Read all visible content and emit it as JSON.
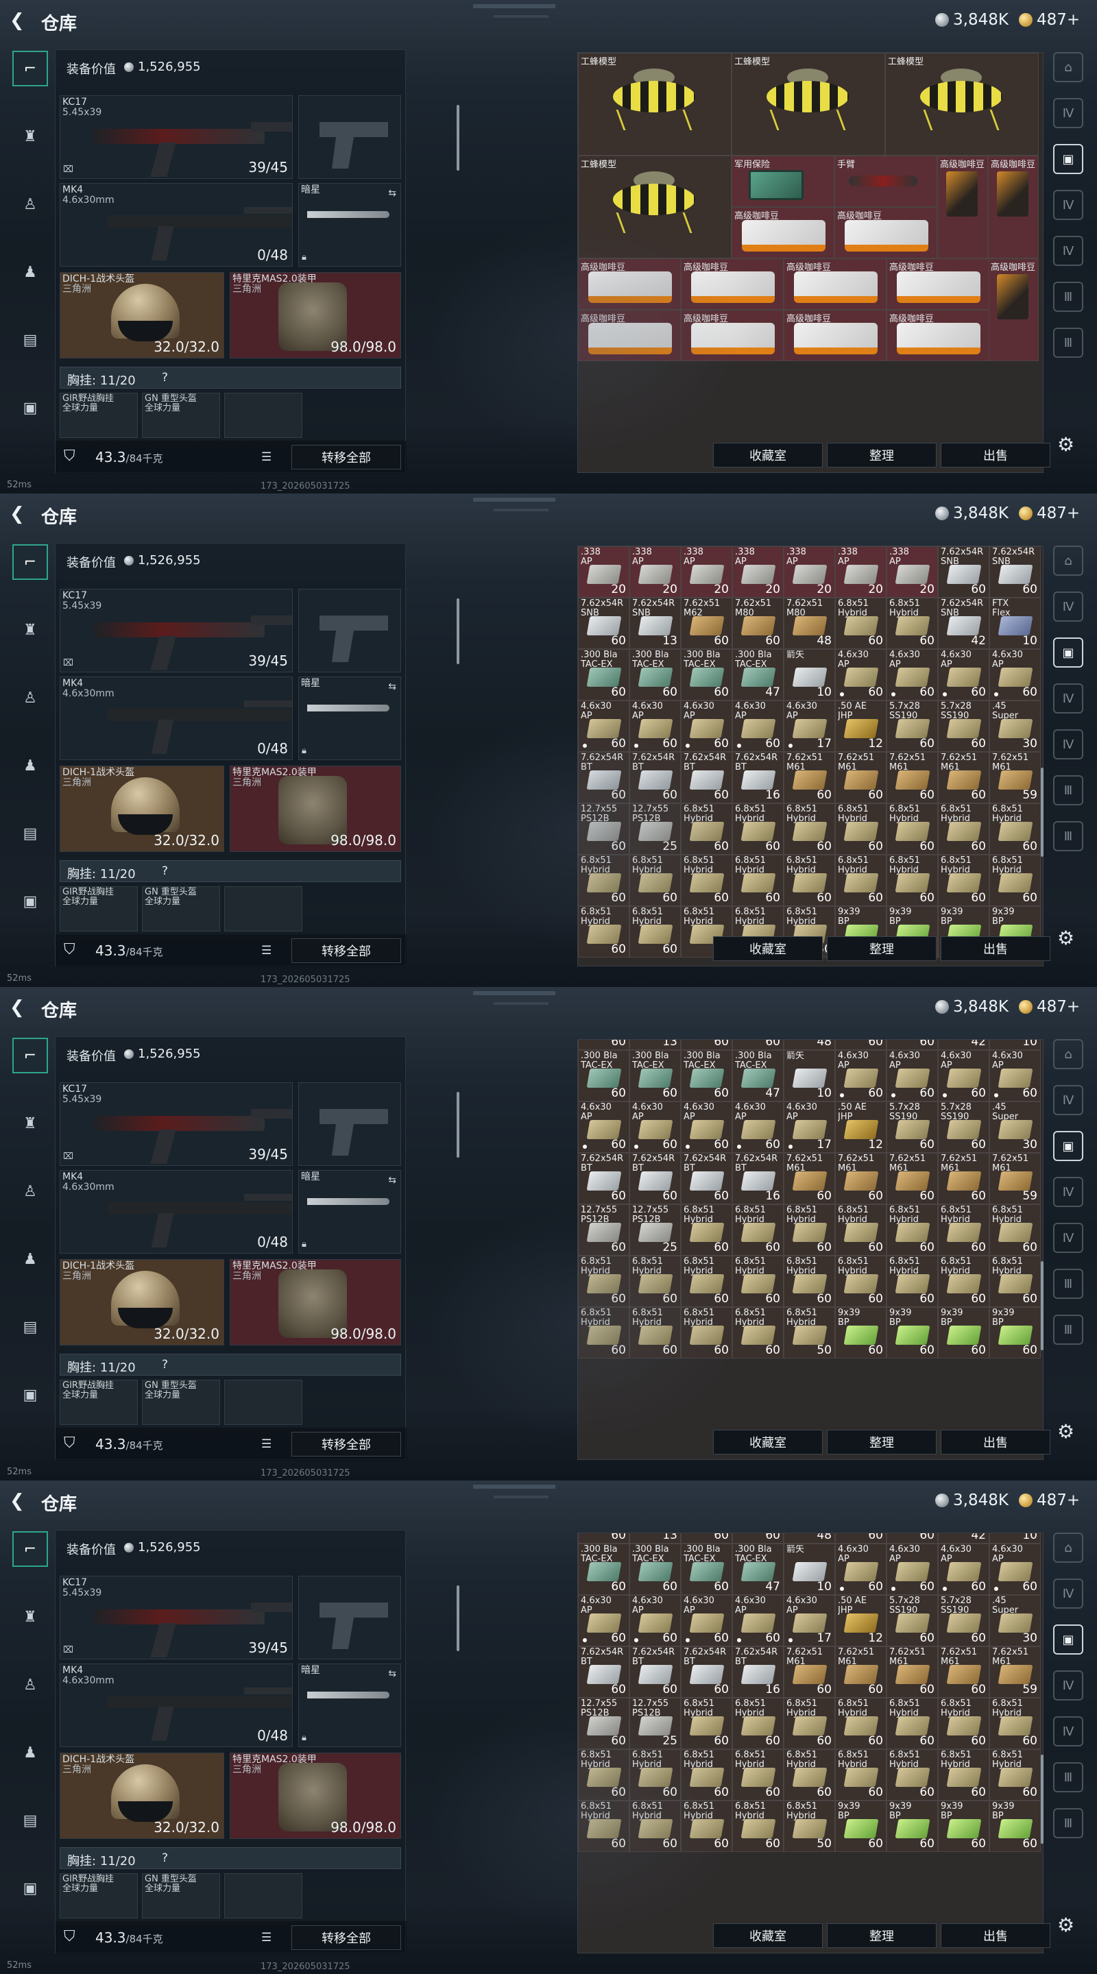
{
  "header": {
    "title": "仓库",
    "silver": "3,848K",
    "gold": "487+"
  },
  "loadout": {
    "value_label": "装备价值",
    "value": "1,526,955",
    "primary": {
      "name": "KC17",
      "caliber": "5.45x39",
      "ammo": "39/45"
    },
    "secondary": {
      "name": "MK4",
      "caliber": "4.6x30mm",
      "ammo": "0/48"
    },
    "melee": {
      "name": "暗星"
    },
    "helmet": {
      "name": "DICH-1战术头盔",
      "sub": "三角洲",
      "durability": "32.0/32.0"
    },
    "armor": {
      "name": "特里克MAS2.0装甲",
      "sub": "三角洲",
      "durability": "98.0/98.0"
    },
    "rig_label": "胸挂:",
    "rig_value": "11/20",
    "rig_q": "?",
    "rig_items": [
      {
        "name": "GIR野战胸挂",
        "sub": "全球力量"
      },
      {
        "name": "GN 重型头盔",
        "sub": "全球力量"
      }
    ],
    "weight": "43.3",
    "weight_max": "/84千克",
    "transfer_all": "转移全部"
  },
  "stash_buttons": {
    "collection": "收藏室",
    "sort": "整理",
    "sell": "出售"
  },
  "status": {
    "ping": "52ms",
    "version": "173_202605031725"
  },
  "colors": {
    "accent_teal": "#2ea58e",
    "slot_red": "#4b2329",
    "stash_bg": "#2e2b2b"
  },
  "icons": [
    "back-icon",
    "gun-icon",
    "vest-icon",
    "backpack-icon",
    "bag-icon",
    "case-icon",
    "briefcase-icon",
    "settings-icon",
    "lock-icon",
    "list-icon",
    "swap-icon"
  ],
  "frame1": {
    "wasp_label": "工蜂模型",
    "case_label": "军用保险",
    "scope_label": "手臂",
    "coffee_label": "高级咖啡豆"
  },
  "ammo": [
    [
      ".338\nAP",
      "20",
      "gray"
    ],
    [
      ".338\nAP",
      "20",
      "gray"
    ],
    [
      ".338\nAP",
      "20",
      "gray"
    ],
    [
      ".338\nAP",
      "20",
      "gray"
    ],
    [
      ".338\nAP",
      "20",
      "gray"
    ],
    [
      ".338\nAP",
      "20",
      "gray"
    ],
    [
      ".338\nAP",
      "20",
      "gray"
    ],
    [
      "7.62x54R\nSNB",
      "60",
      "silver"
    ],
    [
      "7.62x54R\nSNB",
      "60",
      "silver"
    ],
    [
      "7.62x54R\nSNB",
      "60",
      "silver"
    ],
    [
      "7.62x54R\nSNB",
      "13",
      "silver"
    ],
    [
      "7.62x51\nM62",
      "60",
      "tan"
    ],
    [
      "7.62x51\nM80",
      "60",
      "tan"
    ],
    [
      "7.62x51\nM80",
      "48",
      "tan"
    ],
    [
      "6.8x51\nHybrid",
      "60",
      "khaki"
    ],
    [
      "6.8x51\nHybrid",
      "60",
      "khaki"
    ],
    [
      "7.62x54R\nSNB",
      "42",
      "silver"
    ],
    [
      "FTX\nFlex",
      "10",
      "blue"
    ],
    [
      ".300 Bla\nTAC-EX",
      "60",
      "teal"
    ],
    [
      ".300 Bla\nTAC-EX",
      "60",
      "teal"
    ],
    [
      ".300 Bla\nTAC-EX",
      "60",
      "teal"
    ],
    [
      ".300 Bla\nTAC-EX",
      "47",
      "teal"
    ],
    [
      "箭矢\n",
      "10",
      "silver"
    ],
    [
      "4.6x30\nAP",
      "60",
      "khaki"
    ],
    [
      "4.6x30\nAP",
      "60",
      "khaki"
    ],
    [
      "4.6x30\nAP",
      "60",
      "khaki"
    ],
    [
      "4.6x30\nAP",
      "60",
      "khaki"
    ],
    [
      "4.6x30\nAP",
      "60",
      "khaki"
    ],
    [
      "4.6x30\nAP",
      "60",
      "khaki"
    ],
    [
      "4.6x30\nAP",
      "60",
      "khaki"
    ],
    [
      "4.6x30\nAP",
      "60",
      "khaki"
    ],
    [
      "4.6x30\nAP",
      "17",
      "khaki"
    ],
    [
      ".50 AE\nJHP",
      "12",
      "brass"
    ],
    [
      "5.7x28\nSS190",
      "60",
      "khaki"
    ],
    [
      "5.7x28\nSS190",
      "60",
      "khaki"
    ],
    [
      ".45\nSuper",
      "30",
      "khaki"
    ],
    [
      "7.62x54R\nBT",
      "60",
      "silver"
    ],
    [
      "7.62x54R\nBT",
      "60",
      "silver"
    ],
    [
      "7.62x54R\nBT",
      "60",
      "silver"
    ],
    [
      "7.62x54R\nBT",
      "16",
      "silver"
    ],
    [
      "7.62x51\nM61",
      "60",
      "tan"
    ],
    [
      "7.62x51\nM61",
      "60",
      "tan"
    ],
    [
      "7.62x51\nM61",
      "60",
      "tan"
    ],
    [
      "7.62x51\nM61",
      "60",
      "tan"
    ],
    [
      "7.62x51\nM61",
      "59",
      "tan"
    ],
    [
      "12.7x55\nPS12B",
      "60",
      "gray"
    ],
    [
      "12.7x55\nPS12B",
      "25",
      "gray"
    ],
    [
      "6.8x51\nHybrid",
      "60",
      "khaki"
    ],
    [
      "6.8x51\nHybrid",
      "60",
      "khaki"
    ],
    [
      "6.8x51\nHybrid",
      "60",
      "khaki"
    ],
    [
      "6.8x51\nHybrid",
      "60",
      "khaki"
    ],
    [
      "6.8x51\nHybrid",
      "60",
      "khaki"
    ],
    [
      "6.8x51\nHybrid",
      "60",
      "khaki"
    ],
    [
      "6.8x51\nHybrid",
      "60",
      "khaki"
    ],
    [
      "6.8x51\nHybrid",
      "60",
      "khaki"
    ],
    [
      "6.8x51\nHybrid",
      "60",
      "khaki"
    ],
    [
      "6.8x51\nHybrid",
      "60",
      "khaki"
    ],
    [
      "6.8x51\nHybrid",
      "60",
      "khaki"
    ],
    [
      "6.8x51\nHybrid",
      "60",
      "khaki"
    ],
    [
      "6.8x51\nHybrid",
      "60",
      "khaki"
    ],
    [
      "6.8x51\nHybrid",
      "60",
      "khaki"
    ],
    [
      "6.8x51\nHybrid",
      "60",
      "khaki"
    ],
    [
      "6.8x51\nHybrid",
      "60",
      "khaki"
    ],
    [
      "6.8x51\nHybrid",
      "60",
      "khaki"
    ],
    [
      "6.8x51\nHybrid",
      "60",
      "khaki"
    ],
    [
      "6.8x51\nHybrid",
      "60",
      "khaki"
    ],
    [
      "6.8x51\nHybrid",
      "60",
      "khaki"
    ],
    [
      "6.8x51\nHybrid",
      "50",
      "khaki"
    ],
    [
      "9x39\nBP",
      "60",
      "green"
    ],
    [
      "9x39\nBP",
      "60",
      "green"
    ],
    [
      "9x39\nBP",
      "60",
      "green"
    ],
    [
      "9x39\nBP",
      "60",
      "green"
    ]
  ]
}
